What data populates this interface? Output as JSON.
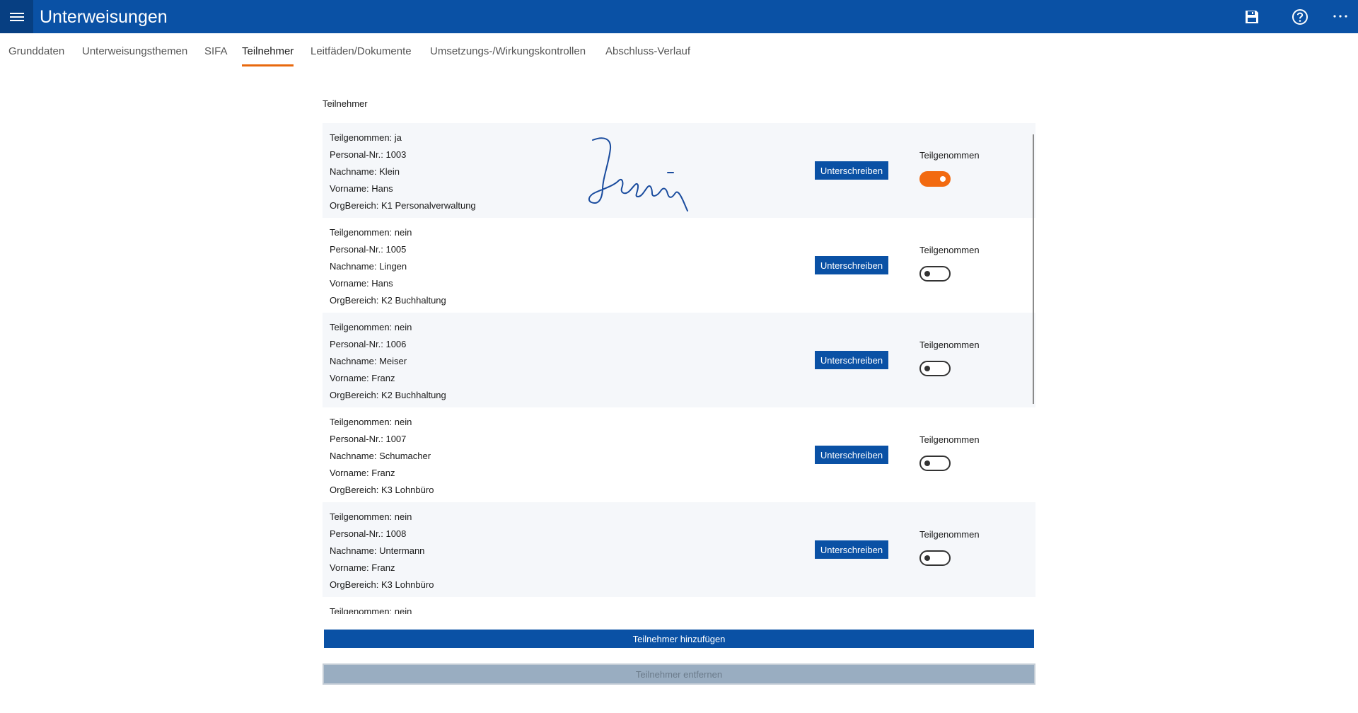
{
  "app": {
    "title": "Unterweisungen"
  },
  "toolbar": {
    "menu_icon": "hamburger-icon",
    "save_icon": "save-icon",
    "help_icon": "help-icon",
    "more_icon": "more-icon"
  },
  "tabs": [
    {
      "label": "Grunddaten",
      "active": false
    },
    {
      "label": "Unterweisungsthemen",
      "active": false
    },
    {
      "label": "SIFA",
      "active": false
    },
    {
      "label": "Teilnehmer",
      "active": true
    },
    {
      "label": "Leitfäden/Dokumente",
      "active": false
    },
    {
      "label": "Umsetzungs-/Wirkungskontrollen",
      "active": false
    },
    {
      "label": "Abschluss-Verlauf",
      "active": false
    }
  ],
  "section": {
    "title": "Teilnehmer"
  },
  "participants": [
    {
      "teilgenommen": "Teilgenommen: ja",
      "personal_nr": "Personal-Nr.: 1003",
      "nachname": "Nachname: Klein",
      "vorname": "Vorname: Hans",
      "orgbereich": "OrgBereich: K1 Personalverwaltung",
      "sign_label": "Unterschreiben",
      "toggle_label": "Teilgenommen",
      "toggle_on": true,
      "has_signature": true
    },
    {
      "teilgenommen": "Teilgenommen: nein",
      "personal_nr": "Personal-Nr.: 1005",
      "nachname": "Nachname: Lingen",
      "vorname": "Vorname: Hans",
      "orgbereich": "OrgBereich: K2 Buchhaltung",
      "sign_label": "Unterschreiben",
      "toggle_label": "Teilgenommen",
      "toggle_on": false,
      "has_signature": false
    },
    {
      "teilgenommen": "Teilgenommen: nein",
      "personal_nr": "Personal-Nr.: 1006",
      "nachname": "Nachname: Meiser",
      "vorname": "Vorname: Franz",
      "orgbereich": "OrgBereich: K2 Buchhaltung",
      "sign_label": "Unterschreiben",
      "toggle_label": "Teilgenommen",
      "toggle_on": false,
      "has_signature": false
    },
    {
      "teilgenommen": "Teilgenommen: nein",
      "personal_nr": "Personal-Nr.: 1007",
      "nachname": "Nachname: Schumacher",
      "vorname": "Vorname: Franz",
      "orgbereich": "OrgBereich: K3 Lohnbüro",
      "sign_label": "Unterschreiben",
      "toggle_label": "Teilgenommen",
      "toggle_on": false,
      "has_signature": false
    },
    {
      "teilgenommen": "Teilgenommen: nein",
      "personal_nr": "Personal-Nr.: 1008",
      "nachname": "Nachname: Untermann",
      "vorname": "Vorname: Franz",
      "orgbereich": "OrgBereich: K3 Lohnbüro",
      "sign_label": "Unterschreiben",
      "toggle_label": "Teilgenommen",
      "toggle_on": false,
      "has_signature": false
    },
    {
      "teilgenommen": "Teilgenommen: nein"
    }
  ],
  "actions": {
    "add_label": "Teilnehmer hinzufügen",
    "remove_label": "Teilnehmer entfernen"
  },
  "colors": {
    "primary": "#0a51a5",
    "accent": "#f26a10",
    "disabled": "#99adc1"
  }
}
